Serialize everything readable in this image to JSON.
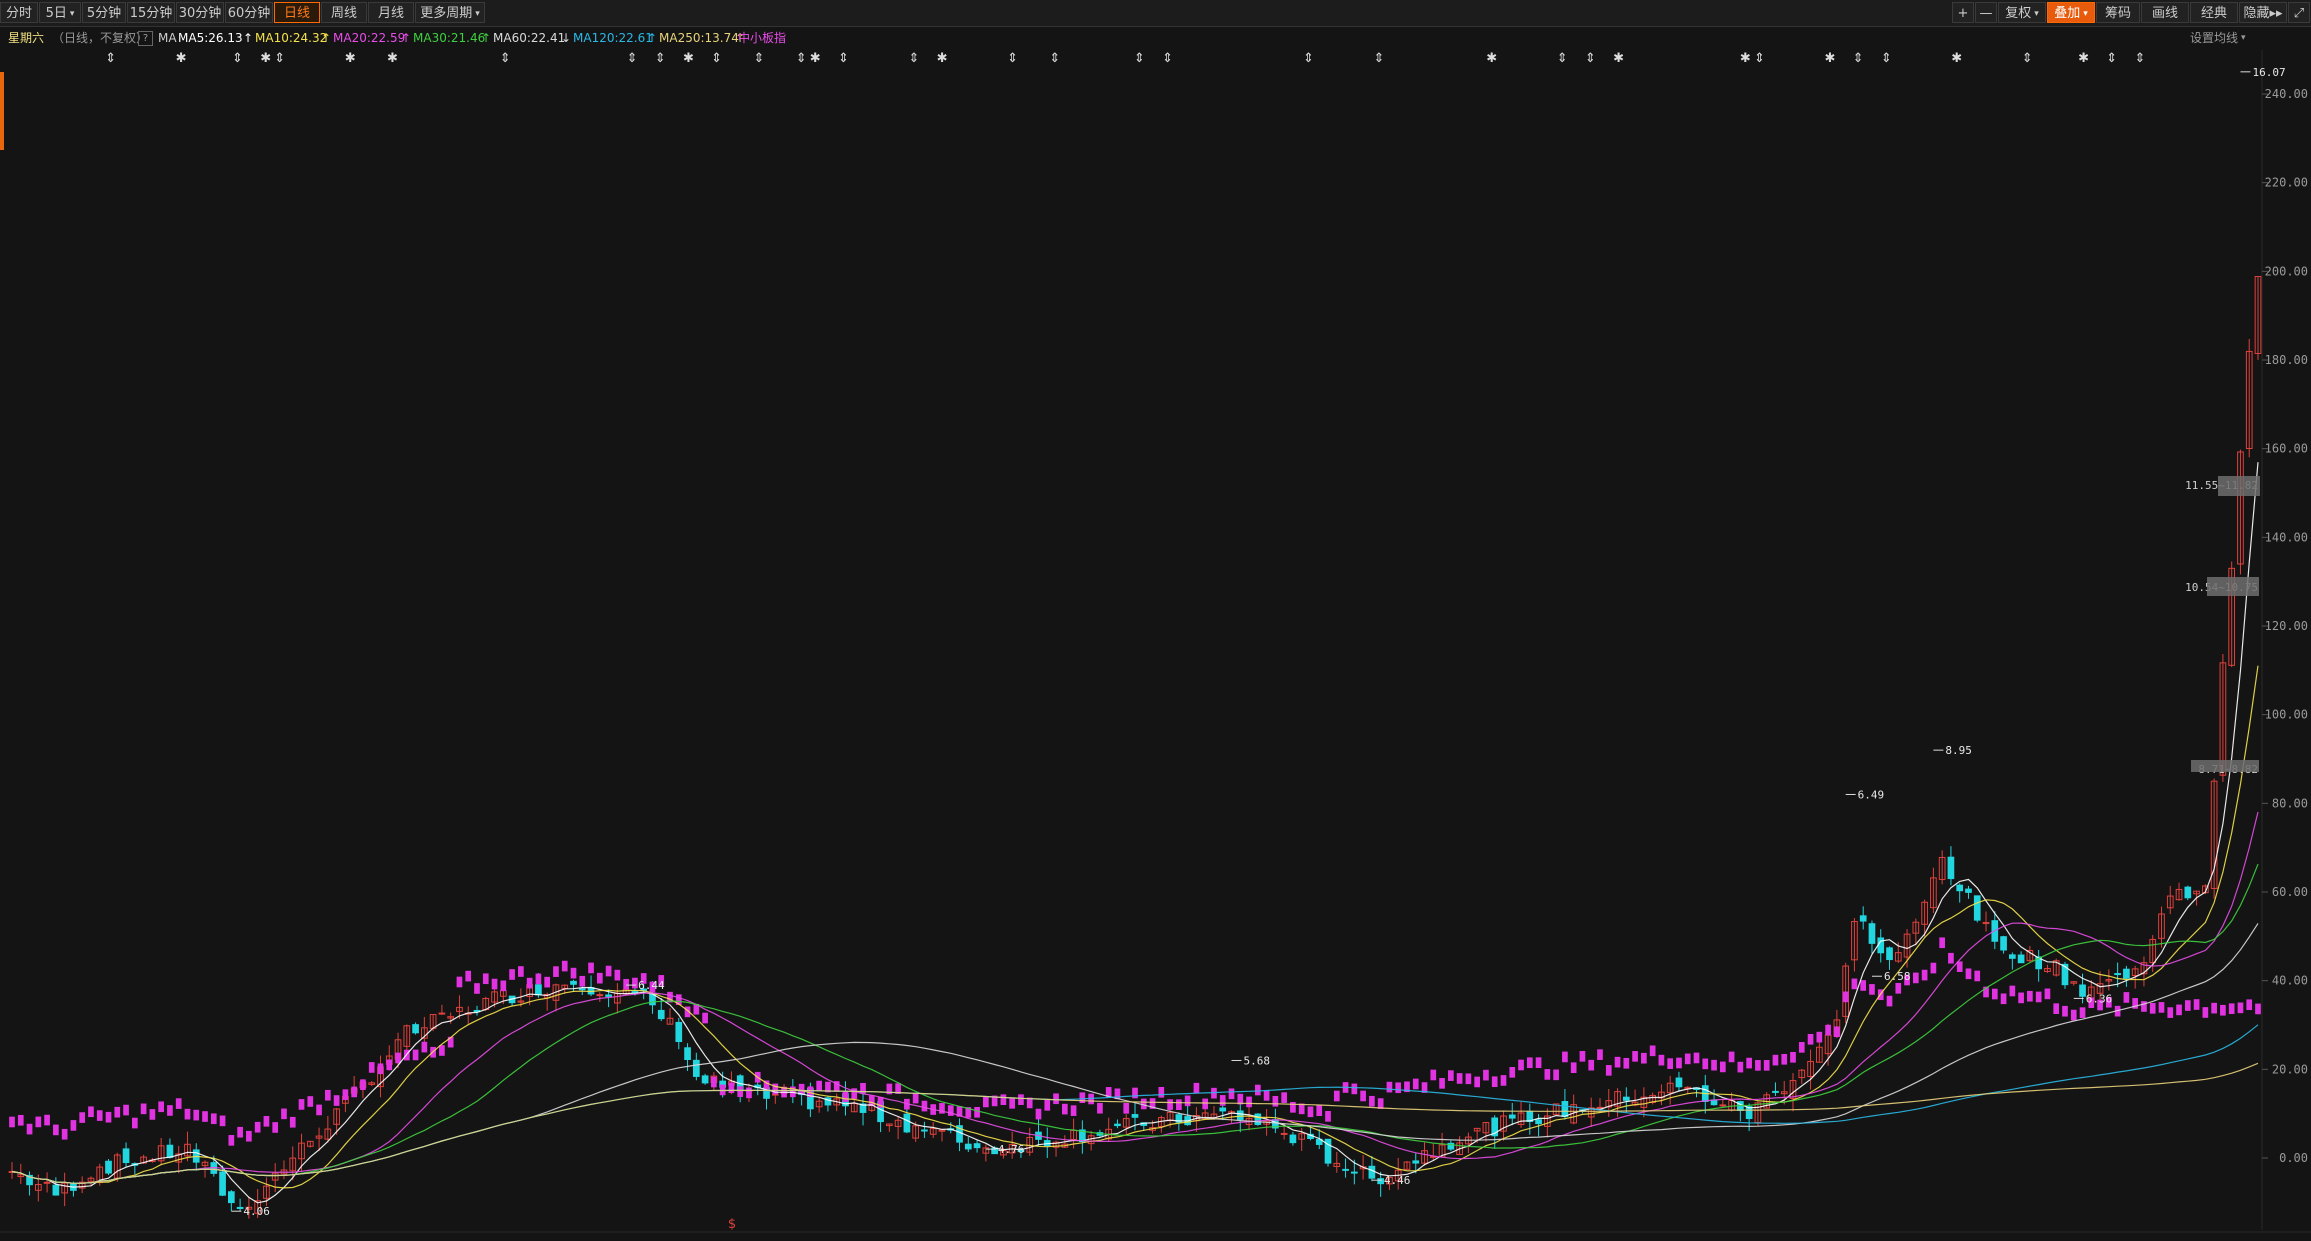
{
  "toolbar": {
    "periods": [
      {
        "label": "分时"
      },
      {
        "label": "5日",
        "caret": true
      },
      {
        "label": "5分钟"
      },
      {
        "label": "15分钟"
      },
      {
        "label": "30分钟"
      },
      {
        "label": "60分钟"
      },
      {
        "label": "日线",
        "active": true
      },
      {
        "label": "周线"
      },
      {
        "label": "月线"
      },
      {
        "label": "更多周期",
        "caret": true
      }
    ],
    "right_tools": [
      {
        "label": "+"
      },
      {
        "label": "—"
      },
      {
        "label": "复权",
        "caret": true
      },
      {
        "label": "叠加",
        "caret": true,
        "highlight": true
      },
      {
        "label": "筹码"
      },
      {
        "label": "画线"
      },
      {
        "label": "经典"
      },
      {
        "label": "隐藏▸▸"
      },
      {
        "label": "⤢"
      }
    ]
  },
  "info": {
    "stock_name": "星期六",
    "mode": "（日线，不复权）",
    "help": "?",
    "ma_label": "MA",
    "ma_lines": [
      {
        "text": "MA5:26.13",
        "color": "#ffffff",
        "arrow": "↑"
      },
      {
        "text": "MA10:24.32",
        "color": "#f3e24a",
        "arrow": "↑"
      },
      {
        "text": "MA20:22.59",
        "color": "#e84de8",
        "arrow": "↑"
      },
      {
        "text": "MA30:21.46",
        "color": "#3ecf3e",
        "arrow": "↑"
      },
      {
        "text": "MA60:22.41",
        "color": "#d9d9d9",
        "arrow": "↓"
      },
      {
        "text": "MA120:22.61",
        "color": "#29b8e6",
        "arrow": "↑"
      },
      {
        "text": "MA250:13.74",
        "color": "#e8d27a",
        "arrow": "↑"
      }
    ],
    "overlay_index": "中小板指",
    "settings": "设置均线"
  },
  "chart_data": {
    "type": "candlestick",
    "y_ticks": [
      "240.00",
      "220.00",
      "200.00",
      "180.00",
      "160.00",
      "140.00",
      "120.00",
      "100.00",
      "80.00",
      "60.00",
      "40.00",
      "20.00",
      "0.00"
    ],
    "ylim": [
      0,
      240
    ],
    "price_labels": [
      {
        "text": "16.07",
        "x_index": 254,
        "value": 245
      },
      {
        "text": "8.95",
        "x_index": 219,
        "value": 92
      },
      {
        "text": "6.49",
        "x_index": 209,
        "value": 82
      },
      {
        "text": "6.58",
        "x_index": 212,
        "value": 41
      },
      {
        "text": "6.36",
        "x_index": 235,
        "value": 36
      },
      {
        "text": "6.44",
        "x_index": 70,
        "value": 39
      },
      {
        "text": "5.68",
        "x_index": 139,
        "value": 22
      },
      {
        "text": "4.76",
        "x_index": 111,
        "value": 2
      },
      {
        "text": "4.46",
        "x_index": 155,
        "value": -5
      },
      {
        "text": "4.06",
        "x_index": 25,
        "value": -12
      }
    ],
    "box_labels": [
      {
        "text": "11.55~11.82",
        "value": 152
      },
      {
        "text": "10.54~10.75",
        "value": 129
      },
      {
        "text": "8.71~8.82",
        "value": 88
      }
    ],
    "event_marker": "$"
  },
  "colors": {
    "up": "#e0413c",
    "down": "#22d6e0",
    "overlay": "#e233e2",
    "bg": "#141414",
    "axis": "#9a9a9a",
    "grid": "#222222",
    "accent": "#ff6a00"
  }
}
